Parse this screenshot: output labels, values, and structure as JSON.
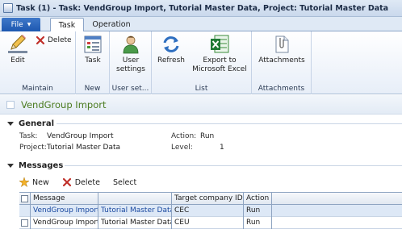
{
  "window": {
    "title": "Task (1) - Task: VendGroup Import, Tutorial Master Data, Project: Tutorial Master Data"
  },
  "ribbon_tabs": {
    "file": "File",
    "task": "Task",
    "operation": "Operation"
  },
  "ribbon": {
    "maintain": {
      "edit": "Edit",
      "delete": "Delete",
      "label": "Maintain"
    },
    "new": {
      "task": "Task",
      "label": "New"
    },
    "user_setup": {
      "user_settings_line1": "User",
      "user_settings_line2": "settings",
      "label": "User set..."
    },
    "list": {
      "refresh": "Refresh",
      "export_line1": "Export to",
      "export_line2": "Microsoft Excel",
      "label": "List"
    },
    "attachments": {
      "attachments": "Attachments",
      "label": "Attachments"
    }
  },
  "record": {
    "title": "VendGroup Import"
  },
  "general": {
    "header": "General",
    "task_label": "Task:",
    "task_value": "VendGroup Import",
    "project_label": "Project:",
    "project_value": "Tutorial Master Data",
    "action_label": "Action:",
    "action_value": "Run",
    "level_label": "Level:",
    "level_value": "1"
  },
  "messages": {
    "header": "Messages",
    "toolbar": {
      "new": "New",
      "delete": "Delete",
      "select": "Select"
    },
    "columns": [
      "Message",
      "",
      "Target company ID",
      "Action"
    ],
    "rows": [
      {
        "message": "VendGroup Import",
        "project": "Tutorial Master Data",
        "company": "CEC",
        "action": "Run"
      },
      {
        "message": "VendGroup Import",
        "project": "Tutorial Master Data",
        "company": "CEU",
        "action": "Run"
      }
    ]
  },
  "colors": {
    "accent": "#1d58b0",
    "record_title": "#4a7b1f",
    "link": "#1a49a0"
  }
}
